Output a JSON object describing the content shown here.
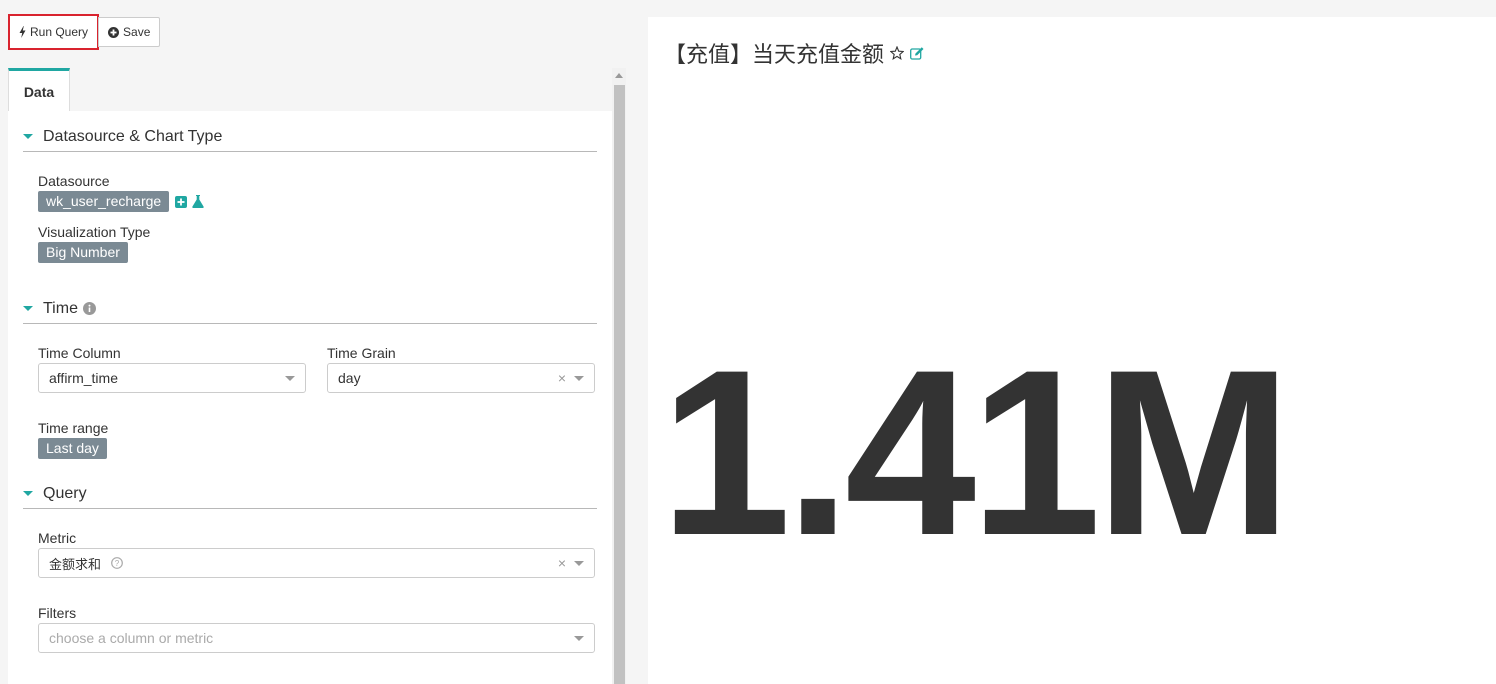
{
  "toolbar": {
    "run_label": "Run Query",
    "save_label": "Save"
  },
  "tabs": [
    {
      "label": "Data"
    }
  ],
  "sections": {
    "datasource": {
      "title": "Datasource & Chart Type",
      "datasource_label": "Datasource",
      "datasource_value": "wk_user_recharge",
      "viz_label": "Visualization Type",
      "viz_value": "Big Number"
    },
    "time": {
      "title": "Time",
      "time_column_label": "Time Column",
      "time_column_value": "affirm_time",
      "time_grain_label": "Time Grain",
      "time_grain_value": "day",
      "time_range_label": "Time range",
      "time_range_value": "Last day"
    },
    "query": {
      "title": "Query",
      "metric_label": "Metric",
      "metric_value": "金额求和",
      "filters_label": "Filters",
      "filters_placeholder": "choose a column or metric"
    }
  },
  "chart": {
    "title": "【充值】当天充值金额",
    "big_number": "1.41M"
  },
  "colors": {
    "accent": "#20a7a2",
    "highlight": "#d9232e",
    "tag_bg": "#7b8a94"
  }
}
